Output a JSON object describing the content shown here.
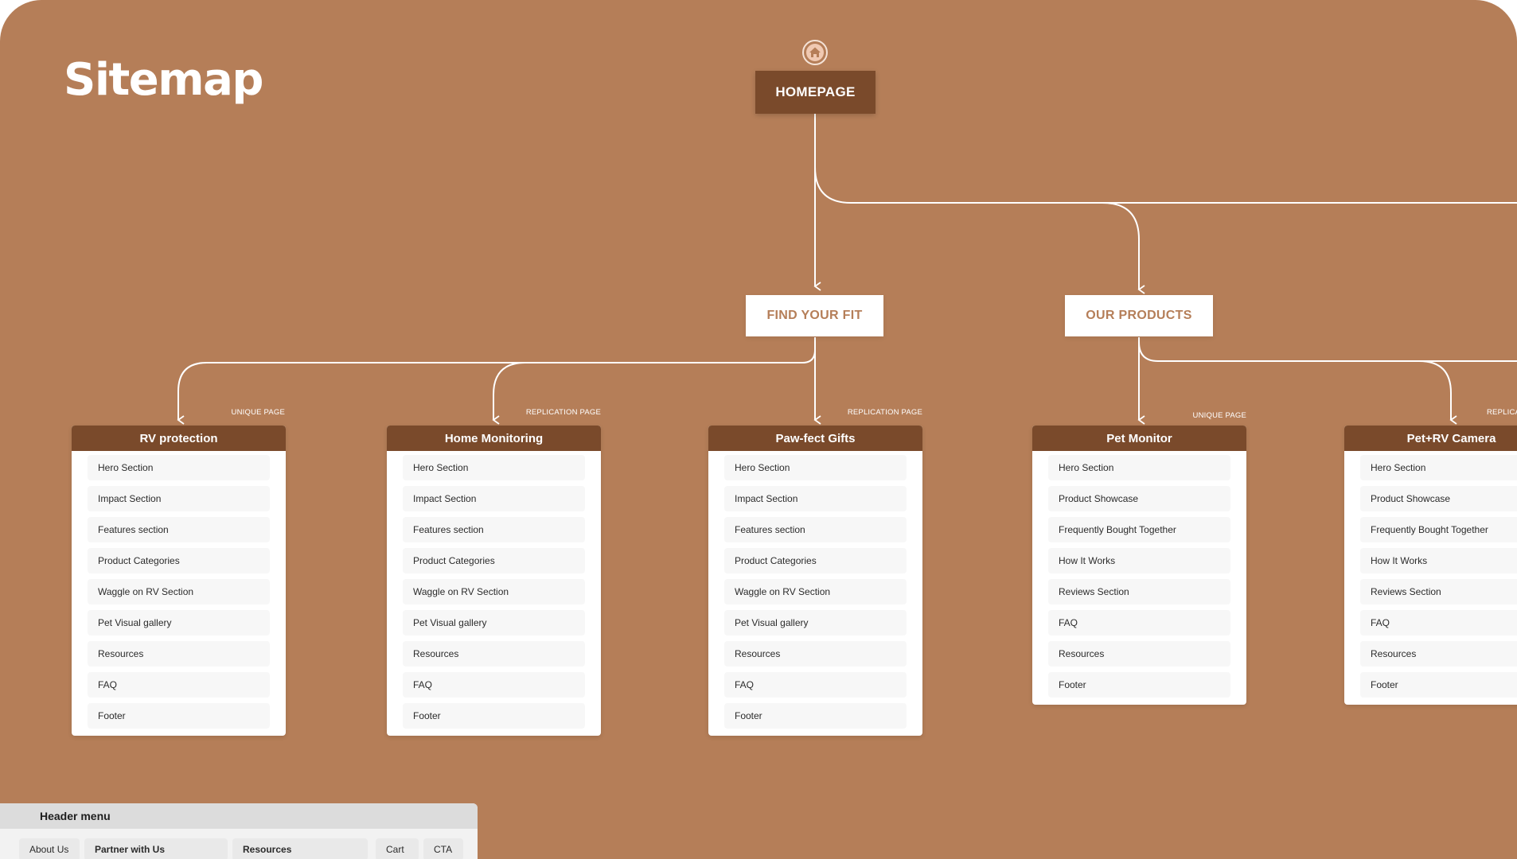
{
  "page": {
    "title": "Sitemap"
  },
  "colors": {
    "background": "#b57e58",
    "dark": "#7a4a2b",
    "light": "#ffffff"
  },
  "root": {
    "label": "HOMEPAGE",
    "icon": "home-icon"
  },
  "level1": [
    {
      "label": "FIND YOUR FIT"
    },
    {
      "label": "OUR PRODUCTS"
    }
  ],
  "cards": [
    {
      "title": "RV protection",
      "tag": "UNIQUE PAGE",
      "items": [
        "Hero Section",
        "Impact Section",
        "Features section",
        "Product Categories",
        "Waggle on RV Section",
        "Pet Visual gallery",
        "Resources",
        "FAQ",
        "Footer"
      ]
    },
    {
      "title": "Home Monitoring",
      "tag": "REPLICATION PAGE",
      "items": [
        "Hero Section",
        "Impact Section",
        "Features section",
        "Product Categories",
        "Waggle on RV Section",
        "Pet Visual gallery",
        "Resources",
        "FAQ",
        "Footer"
      ]
    },
    {
      "title": "Paw-fect Gifts",
      "tag": "REPLICATION PAGE",
      "items": [
        "Hero Section",
        "Impact Section",
        "Features section",
        "Product Categories",
        "Waggle on RV Section",
        "Pet Visual gallery",
        "Resources",
        "FAQ",
        "Footer"
      ]
    },
    {
      "title": "Pet Monitor",
      "tag": "UNIQUE PAGE",
      "items": [
        "Hero Section",
        "Product Showcase",
        "Frequently Bought Together",
        "How It Works",
        "Reviews Section",
        "FAQ",
        "Resources",
        "Footer"
      ]
    },
    {
      "title": "Pet+RV Camera",
      "tag": "REPLICA",
      "items": [
        "Hero Section",
        "Product Showcase",
        "Frequently Bought Together",
        "How It Works",
        "Reviews Section",
        "FAQ",
        "Resources",
        "Footer"
      ]
    }
  ],
  "header_menu": {
    "title": "Header menu",
    "items": [
      "About Us",
      "Partner with Us",
      "Resources",
      "Cart",
      "CTA"
    ]
  }
}
